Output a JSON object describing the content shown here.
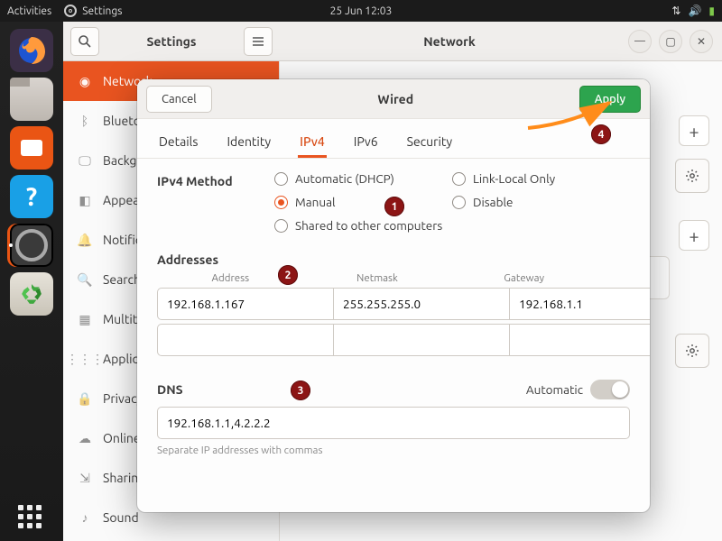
{
  "topbar": {
    "activities": "Activities",
    "app": "Settings",
    "clock": "25 Jun  12:03"
  },
  "settings": {
    "title_left": "Settings",
    "title_right": "Network",
    "sidebar": [
      {
        "label": "Network",
        "icon": "globe-icon",
        "selected": true
      },
      {
        "label": "Bluetooth",
        "icon": "bluetooth-icon"
      },
      {
        "label": "Background",
        "icon": "display-icon"
      },
      {
        "label": "Appearance",
        "icon": "appearance-icon"
      },
      {
        "label": "Notifications",
        "icon": "bell-icon"
      },
      {
        "label": "Search",
        "icon": "search-icon"
      },
      {
        "label": "Multitasking",
        "icon": "multitask-icon"
      },
      {
        "label": "Applications",
        "icon": "grid-icon"
      },
      {
        "label": "Privacy",
        "icon": "lock-icon"
      },
      {
        "label": "Online Accounts",
        "icon": "cloud-icon"
      },
      {
        "label": "Sharing",
        "icon": "share-icon"
      },
      {
        "label": "Sound",
        "icon": "sound-icon"
      }
    ]
  },
  "dialog": {
    "title": "Wired",
    "cancel": "Cancel",
    "apply": "Apply",
    "tabs": {
      "details": "Details",
      "identity": "Identity",
      "ipv4": "IPv4",
      "ipv6": "IPv6",
      "security": "Security",
      "active": "ipv4"
    },
    "ipv4": {
      "method_label": "IPv4 Method",
      "methods": {
        "auto": "Automatic (DHCP)",
        "linklocal": "Link-Local Only",
        "manual": "Manual",
        "disable": "Disable",
        "shared": "Shared to other computers"
      },
      "selected_method": "manual",
      "addresses_label": "Addresses",
      "col_address": "Address",
      "col_netmask": "Netmask",
      "col_gateway": "Gateway",
      "rows": [
        {
          "address": "192.168.1.167",
          "netmask": "255.255.255.0",
          "gateway": "192.168.1.1"
        },
        {
          "address": "",
          "netmask": "",
          "gateway": ""
        }
      ],
      "dns_label": "DNS",
      "dns_auto_label": "Automatic",
      "dns_auto_on": false,
      "dns_value": "192.168.1.1,4.2.2.2",
      "dns_hint": "Separate IP addresses with commas"
    }
  },
  "annotations": {
    "b1": "1",
    "b2": "2",
    "b3": "3",
    "b4": "4"
  }
}
